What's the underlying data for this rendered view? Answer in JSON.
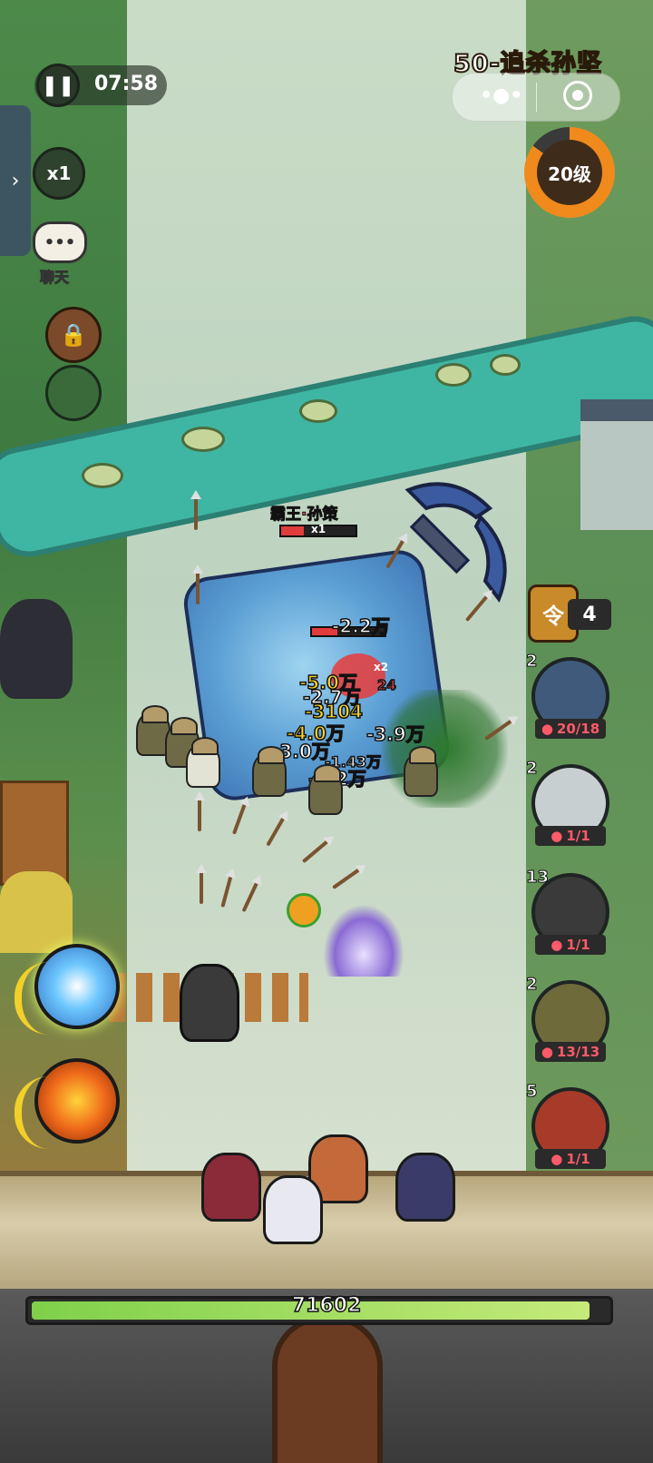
{
  "hud": {
    "timer": "07:58",
    "speed": "x1",
    "chat_label": "聊天",
    "stage_title": "50-追杀孙坚",
    "level_label": "20级",
    "level_progress": 0.85,
    "token_count": "4"
  },
  "boss": {
    "name": "霸王·孙策",
    "stack_label": "x1",
    "stack_label2": "x2"
  },
  "damage_numbers": [
    "-2.2万",
    "-2.7万",
    "-5.0万",
    "-3104",
    "-4.0万",
    "-3.9万",
    "-3.0万",
    "-1.43万",
    "-3.2万",
    "24"
  ],
  "units": [
    {
      "count": "2",
      "troops": "20/18",
      "icon": "armored-general"
    },
    {
      "count": "2",
      "troops": "1/1",
      "icon": "white-robed-strategist"
    },
    {
      "count": "13",
      "troops": "1/1",
      "icon": "crossbowman"
    },
    {
      "count": "2",
      "troops": "13/13",
      "icon": "green-bandana-soldier"
    },
    {
      "count": "5",
      "troops": "1/1",
      "icon": "red-demon-warrior"
    }
  ],
  "base_hp": {
    "value": "71602",
    "fraction": 0.97
  },
  "colors": {
    "accent_orange": "#f08a1c",
    "hp_green": "#7fd04a",
    "troop_red": "#ff5a6a",
    "damage_yellow": "#ffd52a"
  }
}
